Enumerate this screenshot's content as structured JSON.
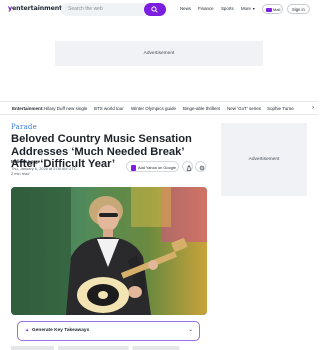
{
  "header": {
    "logo_prefix": "y",
    "logo_text": "entertainment",
    "search_placeholder": "Search the web",
    "nav": [
      "News",
      "Finance",
      "Sports",
      "More"
    ],
    "mail_label": "Mail",
    "signin_label": "Sign in"
  },
  "ads": {
    "top_label": "Advertisement",
    "side_label": "Advertisement"
  },
  "trending": {
    "label": "Entertainment:",
    "items": [
      "Hilary Duff new single",
      "BTS world tour",
      "Winter Olympics guide",
      "Binge-able thrillers",
      "New 'GoT' series",
      "Sophie Turne"
    ]
  },
  "article": {
    "source": "Parade",
    "headline": "Beloved Country Music Sensation Addresses ‘Much Needed Break’ After ‘Difficult Year’",
    "author": "Melinda Lorge",
    "date": "Thu, January 8, 2026 at 2:06 AM UTC",
    "read_time": "2 min read",
    "add_yahoo_label": "Add Yahoo on Google",
    "takeaways_label": "Generate Key Takeaways"
  },
  "colors": {
    "brand_purple": "#7b1ee0",
    "source_blue": "#3a7bd5"
  },
  "icons": {
    "search": "search-icon",
    "mail": "envelope-icon",
    "share": "share-icon",
    "link": "link-icon",
    "takeaways": "sparkle-icon",
    "expand": "chevron-down-icon"
  }
}
